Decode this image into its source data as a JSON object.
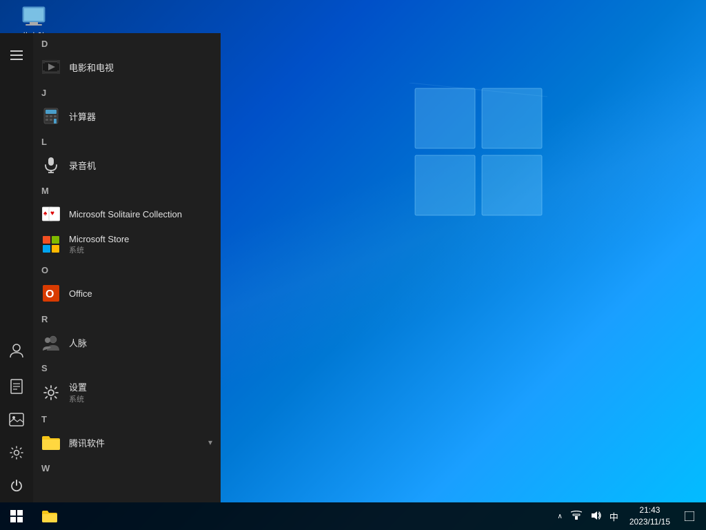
{
  "desktop": {
    "icon": {
      "label": "此电脑"
    },
    "background": {
      "description": "Windows 10 blue gradient wallpaper"
    }
  },
  "start_menu": {
    "sidebar": {
      "icons": [
        {
          "name": "hamburger-menu",
          "symbol": "☰"
        },
        {
          "name": "user-icon",
          "symbol": "👤"
        },
        {
          "name": "documents-icon",
          "symbol": "📄"
        },
        {
          "name": "pictures-icon",
          "symbol": "🖼"
        },
        {
          "name": "settings-icon",
          "symbol": "⚙"
        },
        {
          "name": "power-icon",
          "symbol": "⏻"
        }
      ]
    },
    "sections": [
      {
        "letter": "D",
        "apps": [
          {
            "name": "电影和电视",
            "sub": "",
            "icon": "movie"
          }
        ]
      },
      {
        "letter": "J",
        "apps": [
          {
            "name": "计算器",
            "sub": "",
            "icon": "calc"
          }
        ]
      },
      {
        "letter": "L",
        "apps": [
          {
            "name": "录音机",
            "sub": "",
            "icon": "voice"
          }
        ]
      },
      {
        "letter": "M",
        "apps": [
          {
            "name": "Microsoft Solitaire Collection",
            "sub": "",
            "icon": "solitaire"
          },
          {
            "name": "Microsoft Store",
            "sub": "系统",
            "icon": "store"
          }
        ]
      },
      {
        "letter": "O",
        "apps": [
          {
            "name": "Office",
            "sub": "",
            "icon": "office"
          }
        ]
      },
      {
        "letter": "R",
        "apps": [
          {
            "name": "人脉",
            "sub": "",
            "icon": "people"
          }
        ]
      },
      {
        "letter": "S",
        "apps": [
          {
            "name": "设置",
            "sub": "系统",
            "icon": "settings"
          }
        ]
      },
      {
        "letter": "T",
        "apps": [
          {
            "name": "腾讯软件",
            "sub": "",
            "icon": "folder",
            "has_arrow": true
          }
        ]
      }
    ]
  },
  "taskbar": {
    "start_label": "⊞",
    "tray": {
      "chevron": "∧",
      "lang": "中",
      "time": "21:43",
      "date": "2023/11/15",
      "notification_icon": "🗨"
    }
  }
}
